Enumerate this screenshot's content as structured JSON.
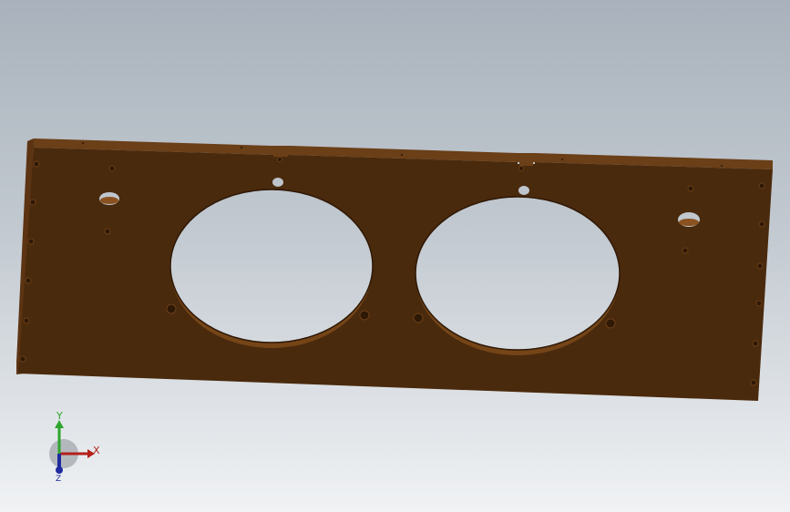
{
  "window": {
    "title": ""
  },
  "viewport": {
    "background_top": "#a9b2bc",
    "background_bottom": "#f0f2f4",
    "model": {
      "part": "plate",
      "material_color": "#4a2a0d",
      "edge_color": "#6b3f17",
      "features": {
        "large_circular_cutouts": 2,
        "top_notches": 2,
        "mounting_holes_visible": true
      }
    }
  },
  "triad": {
    "x_label": "X",
    "y_label": "Y",
    "z_label": "Z",
    "x_color": "#b3201c",
    "y_color": "#2ea52e",
    "z_color": "#1f2a9e"
  }
}
